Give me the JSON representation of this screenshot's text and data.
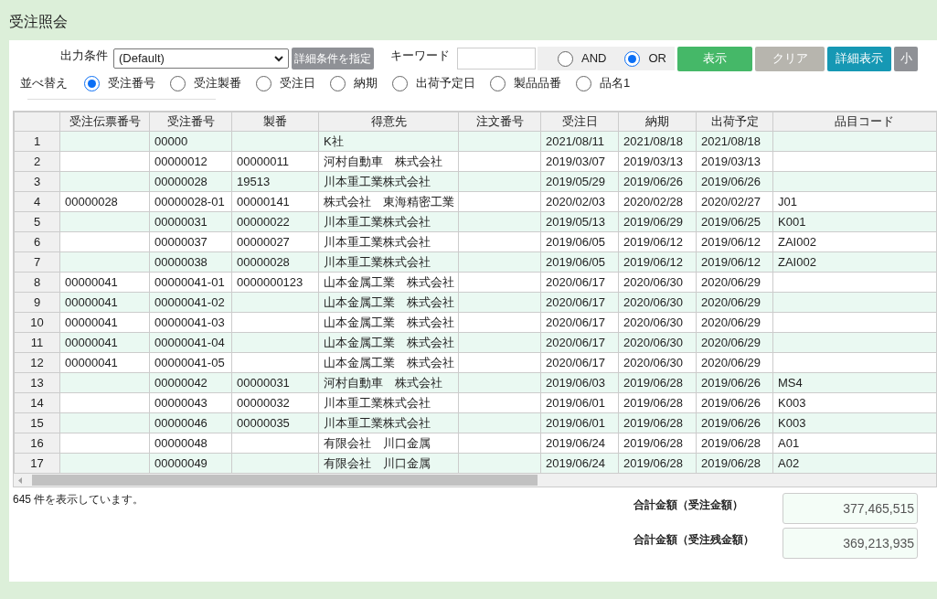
{
  "page_title": "受注照会",
  "filter": {
    "label": "出力条件",
    "select_value": "(Default)",
    "detail_button": "詳細条件を指定",
    "keyword_label": "キーワード",
    "match_modes": [
      {
        "label": "AND",
        "selected": false
      },
      {
        "label": "OR",
        "selected": true
      }
    ],
    "buttons": [
      {
        "label": "表示",
        "kind": "primary"
      },
      {
        "label": "クリア",
        "kind": "muted"
      },
      {
        "label": "詳細表示",
        "kind": "info"
      },
      {
        "label": "小",
        "kind": "small"
      }
    ]
  },
  "sort": {
    "label": "並べ替え",
    "options": [
      {
        "label": "受注番号",
        "selected": true
      },
      {
        "label": "受注製番",
        "selected": false
      },
      {
        "label": "受注日",
        "selected": false
      },
      {
        "label": "納期",
        "selected": false
      },
      {
        "label": "出荷予定日",
        "selected": false
      },
      {
        "label": "製品品番",
        "selected": false
      },
      {
        "label": "品名1",
        "selected": false
      }
    ]
  },
  "table": {
    "columns": [
      "受注伝票番号",
      "受注番号",
      "製番",
      "得意先",
      "注文番号",
      "受注日",
      "納期",
      "出荷予定",
      "品目コード"
    ],
    "rows": [
      {
        "number": "1",
        "cells": [
          "",
          "00000",
          "",
          "K社",
          "",
          "2021/08/11",
          "2021/08/18",
          "2021/08/18",
          ""
        ]
      },
      {
        "number": "2",
        "cells": [
          "",
          "00000012",
          "00000011",
          "河村自動車　株式会社",
          "",
          "2019/03/07",
          "2019/03/13",
          "2019/03/13",
          ""
        ]
      },
      {
        "number": "3",
        "cells": [
          "",
          "00000028",
          "19513",
          "川本重工業株式会社",
          "",
          "2019/05/29",
          "2019/06/26",
          "2019/06/26",
          ""
        ]
      },
      {
        "number": "4",
        "cells": [
          "00000028",
          "00000028-01",
          "00000141",
          "株式会社　東海精密工業",
          "",
          "2020/02/03",
          "2020/02/28",
          "2020/02/27",
          "J01"
        ]
      },
      {
        "number": "5",
        "cells": [
          "",
          "00000031",
          "00000022",
          "川本重工業株式会社",
          "",
          "2019/05/13",
          "2019/06/29",
          "2019/06/25",
          "K001"
        ]
      },
      {
        "number": "6",
        "cells": [
          "",
          "00000037",
          "00000027",
          "川本重工業株式会社",
          "",
          "2019/06/05",
          "2019/06/12",
          "2019/06/12",
          "ZAI002"
        ]
      },
      {
        "number": "7",
        "cells": [
          "",
          "00000038",
          "00000028",
          "川本重工業株式会社",
          "",
          "2019/06/05",
          "2019/06/12",
          "2019/06/12",
          "ZAI002"
        ]
      },
      {
        "number": "8",
        "cells": [
          "00000041",
          "00000041-01",
          "0000000123",
          "山本金属工業　株式会社",
          "",
          "2020/06/17",
          "2020/06/30",
          "2020/06/29",
          ""
        ]
      },
      {
        "number": "9",
        "cells": [
          "00000041",
          "00000041-02",
          "",
          "山本金属工業　株式会社",
          "",
          "2020/06/17",
          "2020/06/30",
          "2020/06/29",
          ""
        ]
      },
      {
        "number": "10",
        "cells": [
          "00000041",
          "00000041-03",
          "",
          "山本金属工業　株式会社",
          "",
          "2020/06/17",
          "2020/06/30",
          "2020/06/29",
          ""
        ]
      },
      {
        "number": "11",
        "cells": [
          "00000041",
          "00000041-04",
          "",
          "山本金属工業　株式会社",
          "",
          "2020/06/17",
          "2020/06/30",
          "2020/06/29",
          ""
        ]
      },
      {
        "number": "12",
        "cells": [
          "00000041",
          "00000041-05",
          "",
          "山本金属工業　株式会社",
          "",
          "2020/06/17",
          "2020/06/30",
          "2020/06/29",
          ""
        ]
      },
      {
        "number": "13",
        "cells": [
          "",
          "00000042",
          "00000031",
          "河村自動車　株式会社",
          "",
          "2019/06/03",
          "2019/06/28",
          "2019/06/26",
          "MS4"
        ]
      },
      {
        "number": "14",
        "cells": [
          "",
          "00000043",
          "00000032",
          "川本重工業株式会社",
          "",
          "2019/06/01",
          "2019/06/28",
          "2019/06/26",
          "K003"
        ]
      },
      {
        "number": "15",
        "cells": [
          "",
          "00000046",
          "00000035",
          "川本重工業株式会社",
          "",
          "2019/06/01",
          "2019/06/28",
          "2019/06/26",
          "K003"
        ]
      },
      {
        "number": "16",
        "cells": [
          "",
          "00000048",
          "",
          "有限会社　川口金属",
          "",
          "2019/06/24",
          "2019/06/28",
          "2019/06/28",
          "A01"
        ]
      },
      {
        "number": "17",
        "cells": [
          "",
          "00000049",
          "",
          "有限会社　川口金属",
          "",
          "2019/06/24",
          "2019/06/28",
          "2019/06/28",
          "A02"
        ]
      }
    ]
  },
  "status": "645 件を表示しています。",
  "totals": [
    {
      "label": "合計金額（受注金額）",
      "value": "377,465,515"
    },
    {
      "label": "合計金額（受注残金額）",
      "value": "369,213,935"
    }
  ]
}
